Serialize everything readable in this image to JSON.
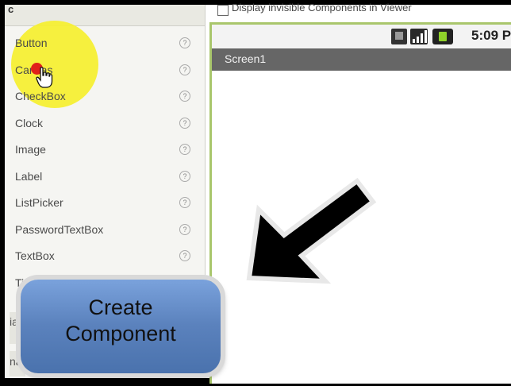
{
  "palette": {
    "header": "c",
    "items": [
      {
        "label": "Button"
      },
      {
        "label": "Canvas"
      },
      {
        "label": "CheckBox"
      },
      {
        "label": "Clock"
      },
      {
        "label": "Image"
      },
      {
        "label": "Label"
      },
      {
        "label": "ListPicker"
      },
      {
        "label": "PasswordTextBox"
      },
      {
        "label": "TextBox"
      },
      {
        "label": "Ti"
      }
    ],
    "help_glyph": "?",
    "side_label_1": "ia",
    "side_label_2": "na"
  },
  "viewer": {
    "checkbox_label": "Display invisible Components in Viewer",
    "status_time": "5:09 P",
    "screen_title": "Screen1"
  },
  "callout": {
    "line1": "Create",
    "line2": "Component"
  },
  "colors": {
    "highlight": "#f6ef2a",
    "button_blue": "#5b82bd",
    "title_bar": "#666666"
  }
}
